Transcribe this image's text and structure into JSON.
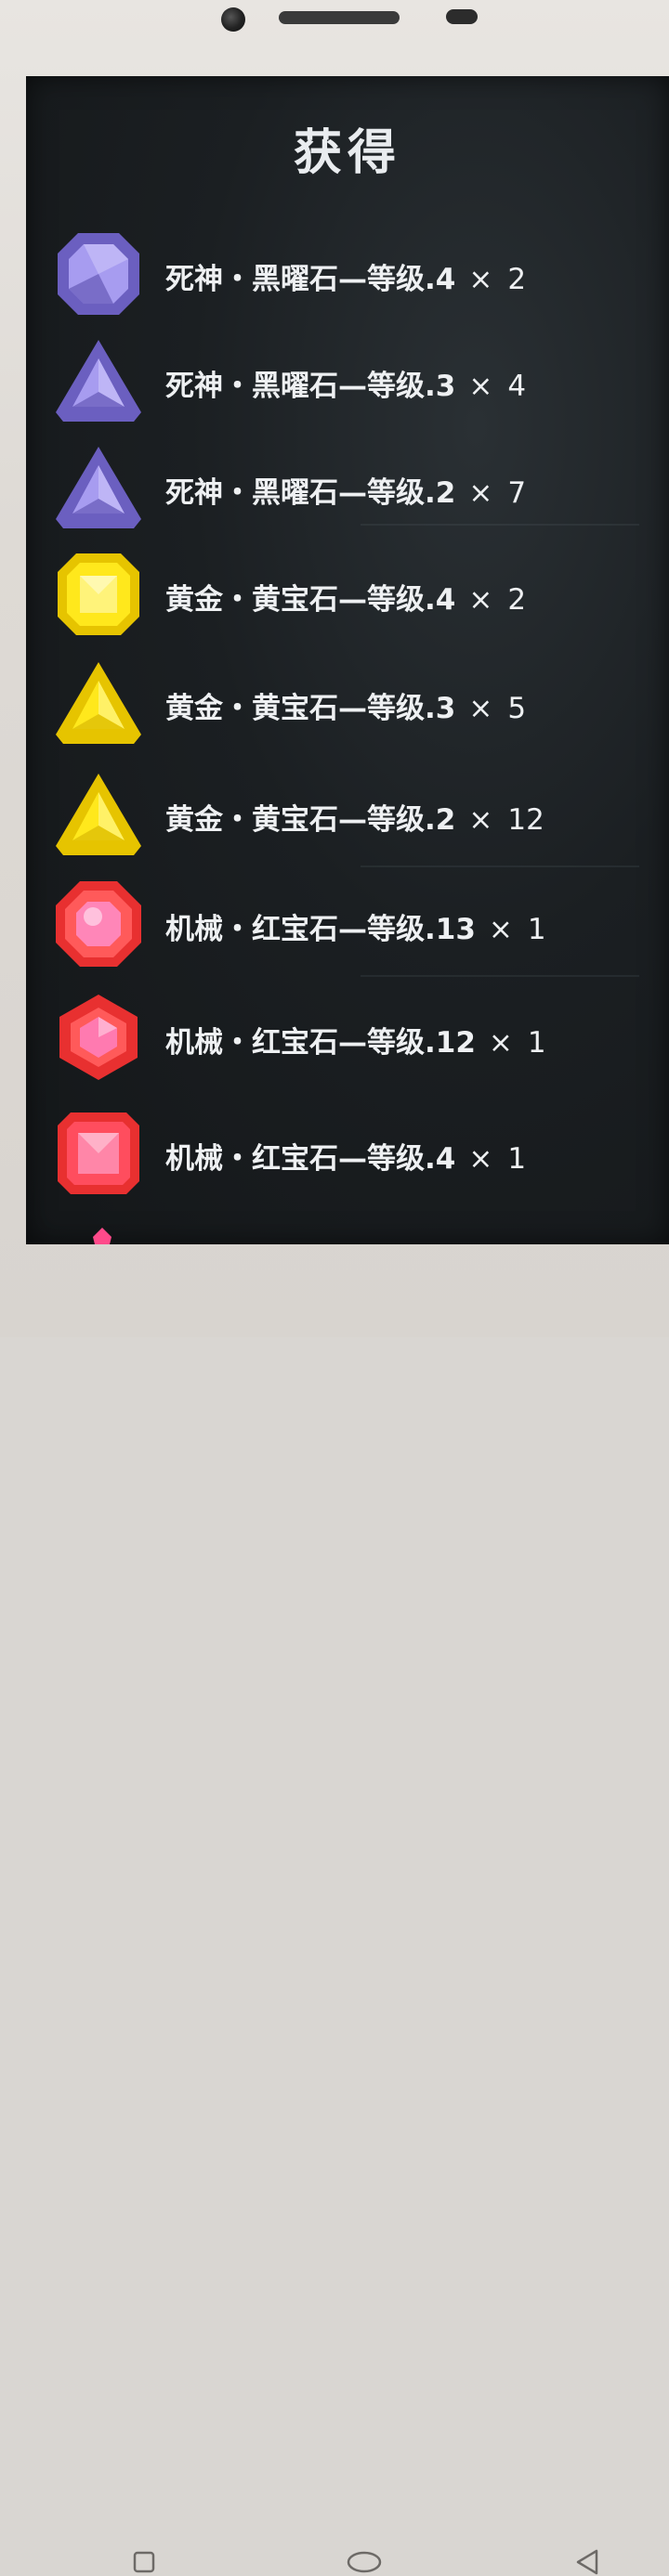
{
  "screen": {
    "title": "获得"
  },
  "items": [
    {
      "label": "死神・黑曜石—等级.4",
      "mult": "×",
      "qty": "2",
      "gem": "amethyst-octagon-icon"
    },
    {
      "label": "死神・黑曜石—等级.3",
      "mult": "×",
      "qty": "4",
      "gem": "amethyst-triangle-icon"
    },
    {
      "label": "死神・黑曜石—等级.2",
      "mult": "×",
      "qty": "7",
      "gem": "amethyst-triangle-icon"
    },
    {
      "label": "黄金・黄宝石—等级.4",
      "mult": "×",
      "qty": "2",
      "gem": "topaz-octagon-icon"
    },
    {
      "label": "黄金・黄宝石—等级.3",
      "mult": "×",
      "qty": "5",
      "gem": "topaz-triangle-icon"
    },
    {
      "label": "黄金・黄宝石—等级.2",
      "mult": "×",
      "qty": "12",
      "gem": "topaz-triangle-icon"
    },
    {
      "label": "机械・红宝石—等级.13",
      "mult": "×",
      "qty": "1",
      "gem": "ruby-octagon-icon"
    },
    {
      "label": "机械・红宝石—等级.12",
      "mult": "×",
      "qty": "1",
      "gem": "ruby-hexagon-icon"
    },
    {
      "label": "机械・红宝石—等级.4",
      "mult": "×",
      "qty": "1",
      "gem": "ruby-square-icon"
    }
  ],
  "colors": {
    "amethyst": "#8a7fd6",
    "topaz": "#f5d90a",
    "ruby": "#ff4a4a",
    "screen_bg": "#1b1f22",
    "text": "#eef0f2"
  },
  "nav": {
    "recent_icon": "square-icon",
    "home_icon": "circle-icon",
    "back_icon": "triangle-back-icon"
  }
}
